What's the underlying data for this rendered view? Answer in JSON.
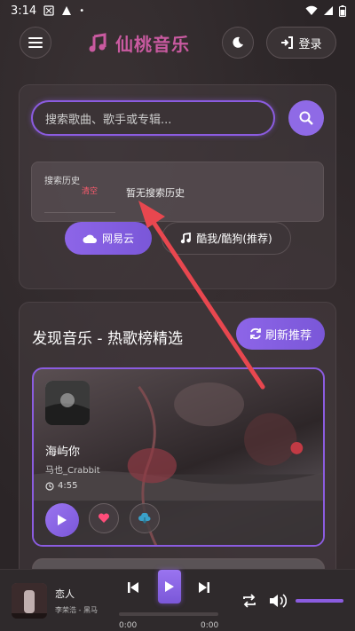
{
  "status_bar": {
    "time": "3:14"
  },
  "header": {
    "brand_title": "仙桃音乐",
    "login_label": "登录"
  },
  "search": {
    "placeholder": "搜索歌曲、歌手或专辑...",
    "history_title": "搜索历史",
    "history_clear": "清空",
    "history_empty": "暂无搜索历史",
    "sources": [
      {
        "label": "网易云",
        "active": true
      },
      {
        "label": "酷我/酷狗(推荐)",
        "active": false
      }
    ]
  },
  "discover": {
    "title": "发现音乐 - 热歌榜精选",
    "refresh_label": "刷新推荐",
    "songs": [
      {
        "title": "海屿你",
        "artist": "马也_Crabbit",
        "duration": "4:55"
      }
    ]
  },
  "player": {
    "title": "恋人",
    "artist": "李荣浩 - 黑马",
    "time_current": "0:00",
    "time_total": "0:00",
    "progress": 0,
    "volume": 1
  },
  "colors": {
    "accent": "#8b5ce0",
    "brand": "#c95aa0",
    "danger": "#ff5b6e",
    "annotation_arrow": "#e8474f"
  },
  "icons": [
    "menu-icon",
    "music-note-icon",
    "moon-icon",
    "sign-in-icon",
    "search-icon",
    "cloud-icon",
    "clock-icon",
    "play-icon",
    "heart-icon",
    "download-icon",
    "refresh-icon",
    "prev-icon",
    "next-icon",
    "repeat-icon",
    "volume-icon"
  ]
}
